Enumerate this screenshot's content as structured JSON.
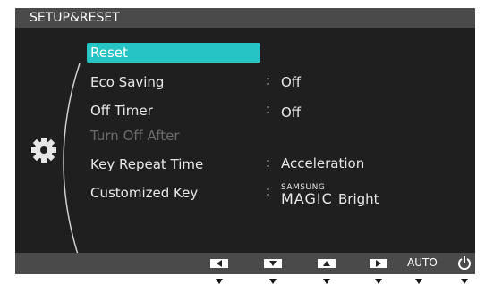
{
  "title": "SETUP&RESET",
  "menu": {
    "items": [
      {
        "label": "Reset",
        "value": "",
        "state": "selected"
      },
      {
        "label": "Eco Saving",
        "value": "Off",
        "state": "normal"
      },
      {
        "label": "Off Timer",
        "value": "Off",
        "state": "normal"
      },
      {
        "label": "Turn Off After",
        "value": "",
        "state": "disabled"
      },
      {
        "label": "Key Repeat Time",
        "value": "Acceleration",
        "state": "normal"
      },
      {
        "label": "Customized Key",
        "value": "",
        "state": "normal"
      }
    ],
    "colon": ":",
    "customized_value": {
      "brand": "SAMSUNG",
      "magic": "MAGIC",
      "bright": "Bright"
    }
  },
  "bottom_bar": {
    "buttons": [
      "left-arrow-icon",
      "down-arrow-icon",
      "up-arrow-icon",
      "right-arrow-icon"
    ],
    "auto_label": "AUTO",
    "power_icon": "power-icon"
  },
  "colors": {
    "title_bg": "#4a4a4a",
    "panel_bg": "#1f1f1f",
    "highlight": "#26c4c4",
    "disabled_text": "#6b6b6b"
  }
}
